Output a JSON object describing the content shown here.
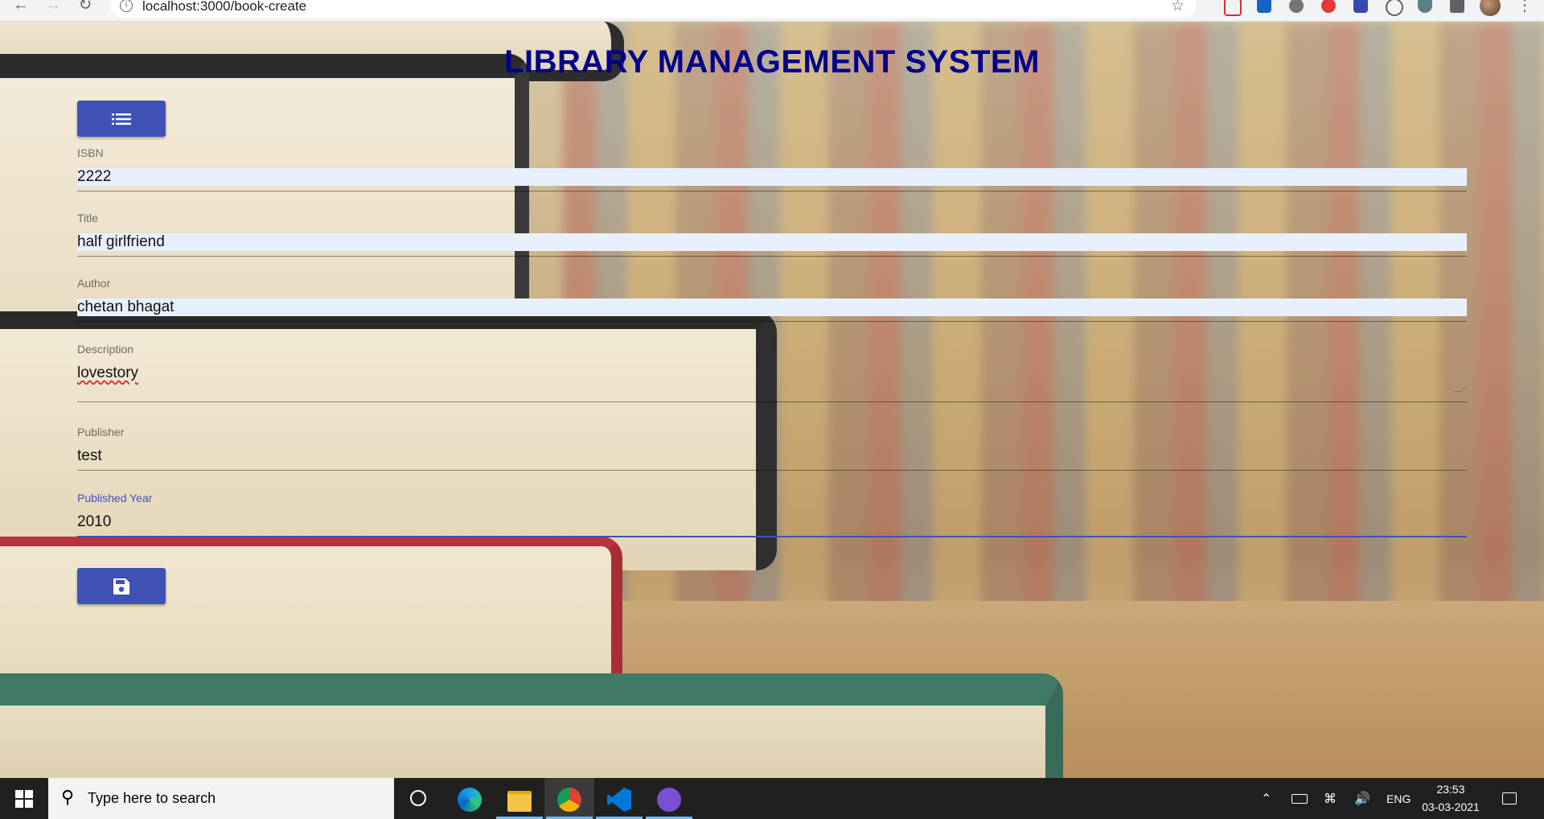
{
  "browser": {
    "url": "localhost:3000/book-create",
    "info_icon": "info-icon",
    "star_icon": "star-icon"
  },
  "page": {
    "title": "LIBRARY MANAGEMENT SYSTEM"
  },
  "form": {
    "fields": [
      {
        "label": "ISBN",
        "value": "2222"
      },
      {
        "label": "Title",
        "value": "half girlfriend"
      },
      {
        "label": "Author",
        "value": "chetan bhagat"
      },
      {
        "label": "Description",
        "value": "lovestory"
      },
      {
        "label": "Publisher",
        "value": "test"
      },
      {
        "label": "Published Year",
        "value": "2010"
      }
    ],
    "list_button_icon": "list-icon",
    "save_button_icon": "save-icon"
  },
  "taskbar": {
    "search_placeholder": "Type here to search",
    "language": "ENG",
    "time": "23:53",
    "date": "03-03-2021"
  },
  "colors": {
    "accent": "#3f51b5",
    "title": "#00008b",
    "autofill": "#e8f0fe"
  }
}
